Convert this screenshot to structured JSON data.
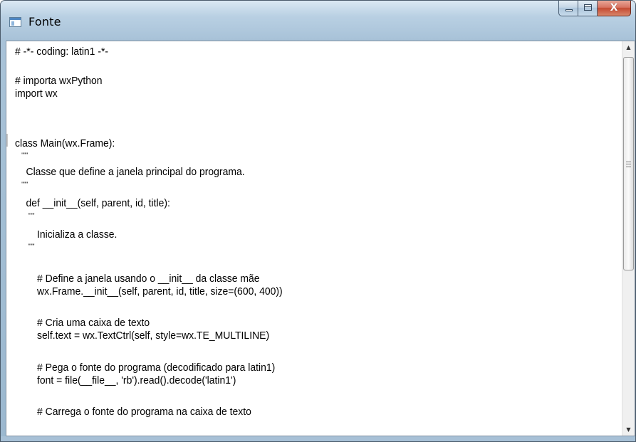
{
  "window": {
    "title": "Fonte",
    "icon": "app-window-icon",
    "buttons": {
      "minimize": "minimize-icon",
      "maximize": "maximize-icon",
      "close": "X"
    }
  },
  "editor": {
    "lines": [
      "# -*- coding: latin1 -*-",
      "",
      "# importa wxPython",
      "import wx",
      "",
      "",
      "class Main(wx.Frame):",
      "    \"\"\"",
      "    Classe que define a janela principal do programa.",
      "    \"\"\"",
      "    def __init__(self, parent, id, title):",
      "        \"\"\"",
      "        Inicializa a classe.",
      "        \"\"\"",
      "",
      "        # Define a janela usando o __init__ da classe mãe",
      "        wx.Frame.__init__(self, parent, id, title, size=(600, 400))",
      "",
      "        # Cria uma caixa de texto",
      "        self.text = wx.TextCtrl(self, style=wx.TE_MULTILINE)",
      "",
      "        # Pega o fonte do programa (decodificado para latin1)",
      "        font = file(__file__, 'rb').read().decode('latin1')",
      "",
      "        # Carrega o fonte do programa na caixa de texto"
    ]
  },
  "scrollbar": {
    "up_arrow": "▲",
    "down_arrow": "▼"
  }
}
